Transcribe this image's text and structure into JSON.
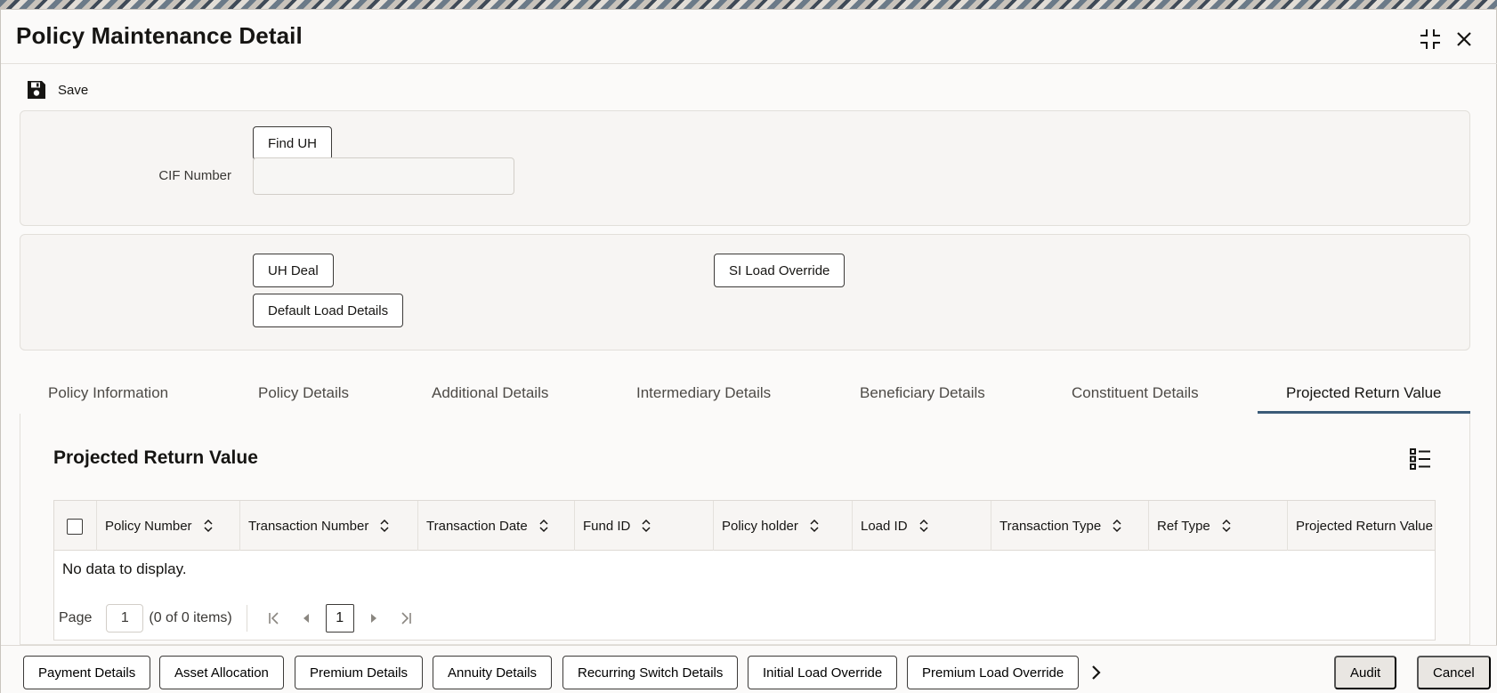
{
  "window": {
    "title": "Policy Maintenance Detail"
  },
  "toolbar": {
    "save_label": "Save"
  },
  "cif_panel": {
    "find_uh_label": "Find UH",
    "cif_label": "CIF Number",
    "cif_value": ""
  },
  "actions_panel": {
    "uh_deal_label": "UH Deal",
    "default_load_label": "Default Load Details",
    "si_load_label": "SI Load Override"
  },
  "tabs": [
    {
      "label": "Policy Information"
    },
    {
      "label": "Policy Details"
    },
    {
      "label": "Additional Details"
    },
    {
      "label": "Intermediary Details"
    },
    {
      "label": "Beneficiary Details"
    },
    {
      "label": "Constituent Details"
    },
    {
      "label": "Projected Return Value",
      "active": true
    }
  ],
  "section": {
    "title": "Projected Return Value"
  },
  "grid": {
    "columns": [
      "Policy Number",
      "Transaction Number",
      "Transaction Date",
      "Fund ID",
      "Policy holder",
      "Load ID",
      "Transaction Type",
      "Ref Type",
      "Projected Return Value"
    ],
    "empty_text": "No data to display.",
    "pager": {
      "page_label": "Page",
      "page_value": "1",
      "count_text": "(0 of 0 items)",
      "current_page": "1"
    }
  },
  "footer": {
    "buttons": [
      "Payment Details",
      "Asset Allocation",
      "Premium Details",
      "Annuity Details",
      "Recurring Switch Details",
      "Initial Load Override",
      "Premium Load Override"
    ],
    "audit_label": "Audit",
    "cancel_label": "Cancel"
  },
  "colors": {
    "accent_underline": "#3b5b78",
    "panel_bg": "#f7f5f3",
    "text": "#161513"
  }
}
